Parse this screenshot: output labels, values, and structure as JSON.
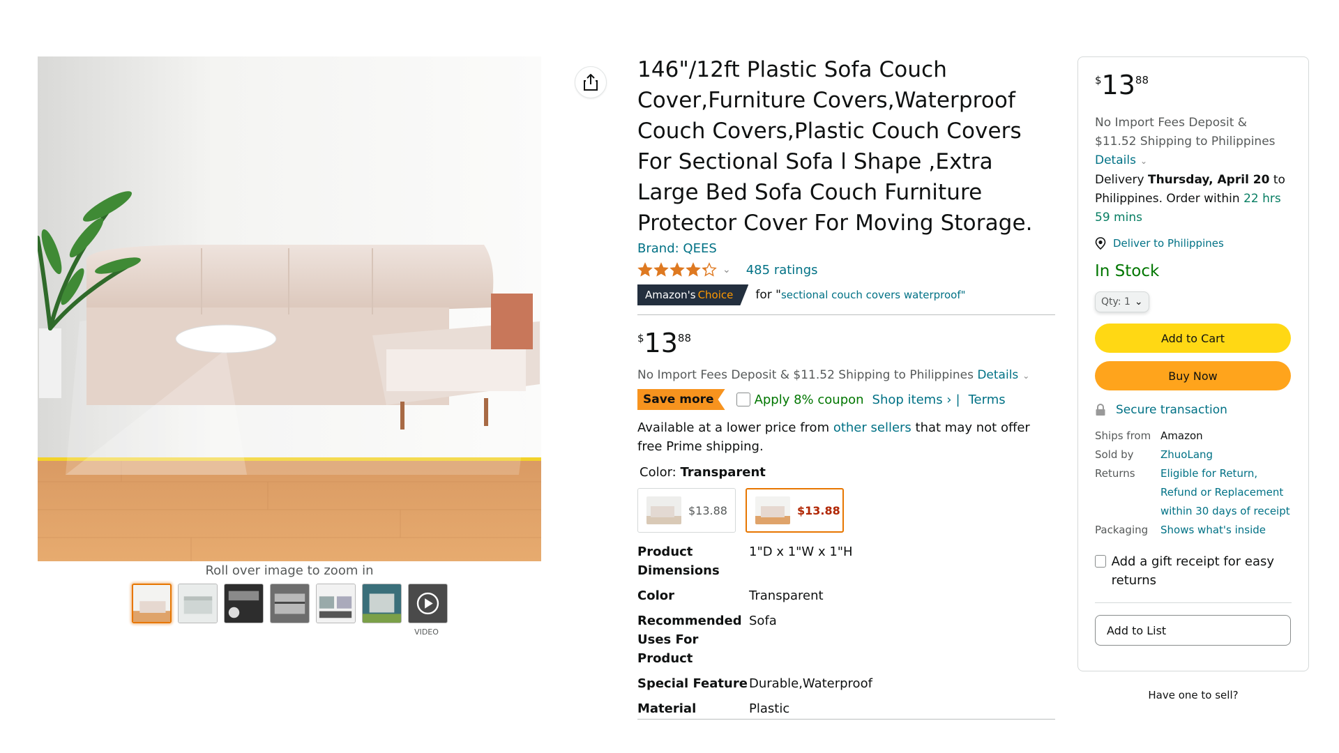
{
  "gallery": {
    "zoom_hint": "Roll over image to zoom in",
    "video_label": "VIDEO",
    "thumbnail_count": 7
  },
  "product": {
    "title": "146\"/12ft Plastic Sofa Couch Cover,Furniture Covers,Waterproof Couch Covers,Plastic Couch Covers For Sectional Sofa l Shape ,Extra Large Bed Sofa Couch Furniture Protector Cover For Moving Storage.",
    "brand": "Brand: QEES",
    "rating_stars": 4.3,
    "ratings_count": "485 ratings",
    "choice_badge_a": "Amazon's",
    "choice_badge_b": "Choice",
    "choice_for": "for \"",
    "choice_query": "sectional couch covers waterproof",
    "choice_close": "\""
  },
  "price": {
    "symbol": "$",
    "whole": "13",
    "fraction": "88"
  },
  "shipping": {
    "import_text": "No Import Fees Deposit & $11.52 Shipping to Philippines",
    "details_label": "Details"
  },
  "coupon": {
    "save_more": "Save more",
    "apply": "Apply 8% coupon",
    "shop_items": "Shop items ›",
    "separator": "|",
    "terms": "Terms"
  },
  "availability": {
    "prefix": "Available at a lower price from ",
    "link": "other sellers",
    "suffix": " that may not offer free Prime shipping."
  },
  "color": {
    "label": "Color: ",
    "value": "Transparent",
    "swatches": [
      {
        "price": "$13.88",
        "selected": false
      },
      {
        "price": "$13.88",
        "selected": true
      }
    ]
  },
  "specs": [
    {
      "key": "Product Dimensions",
      "value": "1\"D x 1\"W x 1\"H"
    },
    {
      "key": "Color",
      "value": "Transparent"
    },
    {
      "key": "Recommended Uses For Product",
      "value": "Sofa"
    },
    {
      "key": "Special Feature",
      "value": "Durable,Waterproof"
    },
    {
      "key": "Material",
      "value": "Plastic"
    }
  ],
  "buybox": {
    "import_text": "No Import Fees Deposit & $11.52 Shipping to Philippines",
    "details_label": "Details",
    "delivery_prefix": "Delivery ",
    "delivery_date": "Thursday, April 20",
    "delivery_mid": " to Philippines. Order within ",
    "delivery_countdown": "22 hrs 59 mins",
    "deliver_to": "Deliver to Philippines",
    "stock": "In Stock",
    "qty_label": "Qty: 1",
    "add_to_cart": "Add to Cart",
    "buy_now": "Buy Now",
    "secure": "Secure transaction",
    "info": [
      {
        "key": "Ships from",
        "value": "Amazon",
        "link": false
      },
      {
        "key": "Sold by",
        "value": "ZhuoLang",
        "link": true
      },
      {
        "key": "Returns",
        "value": "Eligible for Return, Refund or Replacement within 30 days of receipt",
        "link": true
      },
      {
        "key": "Packaging",
        "value": "Shows what's inside",
        "link": true
      }
    ],
    "gift_receipt": "Add a gift receipt for easy returns",
    "add_to_list": "Add to List",
    "have_one": "Have one to sell?"
  },
  "colors": {
    "link": "#007185",
    "in_stock": "#007600",
    "cart_button": "#ffd814",
    "buy_button": "#ffa41c",
    "save_more": "#f7931e",
    "selected_border": "#e77600"
  }
}
